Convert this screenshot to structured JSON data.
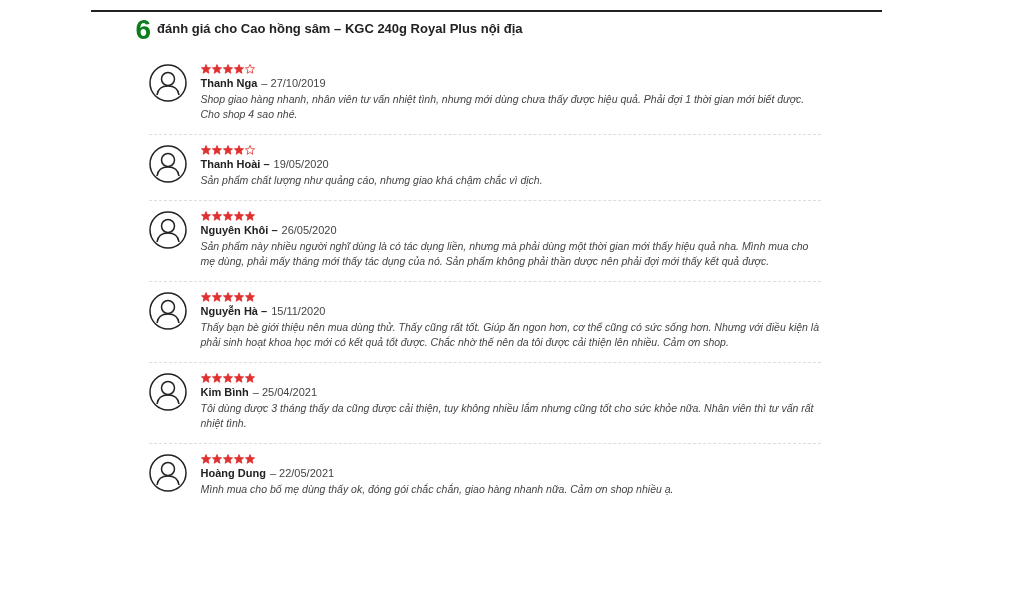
{
  "heading": {
    "count": "6",
    "title": "đánh giá cho Cao hồng sâm – KGC 240g Royal Plus nội địa"
  },
  "reviews": [
    {
      "stars": 4,
      "name": "Thanh Nga",
      "date": "– 27/10/2019",
      "text": "Shop giao hàng nhanh, nhân viên tư vấn nhiệt tình, nhưng mới dùng chưa thấy được hiệu quả. Phải đợi 1 thời gian mới biết được. Cho shop 4 sao nhé."
    },
    {
      "stars": 4,
      "name": "Thanh Hoài –",
      "date": "19/05/2020",
      "text": "Sản phẩm chất lượng như quảng cáo, nhưng giao khá chậm chắc vì dịch."
    },
    {
      "stars": 5,
      "name": "Nguyên Khôi –",
      "date": "26/05/2020",
      "text": "Sản phẩm này nhiều người nghĩ dùng là có tác dụng liền, nhưng mà phải dùng một thời gian mới thấy hiệu quả nha. Mình mua cho mẹ dùng, phải mấy tháng mới thấy tác dụng của nó. Sản phẩm không phải thần dược nên phải đợi mới thấy kết quả được."
    },
    {
      "stars": 5,
      "name": "Nguyễn Hà –",
      "date": "15/11/2020",
      "text": "Thấy bạn bè giới thiệu nên mua dùng thử. Thấy cũng rất tốt. Giúp ăn ngon hơn, cơ thể cũng có sức sống hơn. Nhưng với điều kiện là phải sinh hoạt khoa học mới có kết quả tốt được. Chắc nhờ thế nên da tôi được cải thiện lên nhiều. Cảm ơn shop."
    },
    {
      "stars": 5,
      "name": "Kim Bình",
      "date": "– 25/04/2021",
      "text": "Tôi dùng được 3 tháng thấy da cũng được cải thiện, tuy không nhiều lắm nhưng cũng tốt cho sức khỏe nữa. Nhân viên thì tư vấn rất nhiệt tình."
    },
    {
      "stars": 5,
      "name": "Hoàng Dung",
      "date": "– 22/05/2021",
      "text": "Mình mua cho bố mẹ dùng thấy ok, đóng gói chắc chắn, giao hàng nhanh nữa. Cảm ơn shop nhiều ạ."
    }
  ]
}
